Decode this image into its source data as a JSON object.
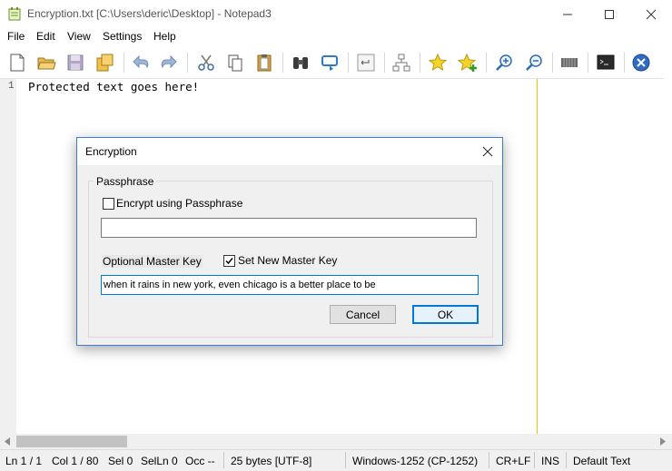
{
  "window": {
    "title": "Encryption.txt [C:\\Users\\deric\\Desktop] - Notepad3"
  },
  "menu": [
    "File",
    "Edit",
    "View",
    "Settings",
    "Help"
  ],
  "editor": {
    "line_number": "1",
    "text": "Protected text goes here!"
  },
  "dialog": {
    "title": "Encryption",
    "group_label": "Passphrase",
    "encrypt_label": "Encrypt using Passphrase",
    "encrypt_checked": false,
    "passphrase_value": "",
    "master_key_label": "Optional Master Key",
    "set_master_label": "Set New Master Key",
    "set_master_checked": true,
    "master_key_value": "when it rains in new york, even chicago is a better place to be",
    "cancel_label": "Cancel",
    "ok_label": "OK"
  },
  "status": {
    "ln": "Ln 1 / 1",
    "col": "Col 1 / 80",
    "sel": "Sel 0",
    "selln": "SelLn 0",
    "occ": "Occ --",
    "size": "25 bytes [UTF-8]",
    "encoding": "Windows-1252 (CP-1252)",
    "eol": "CR+LF",
    "ins": "INS",
    "scheme": "Default Text"
  },
  "colors": {
    "accent": "#3d7cc9",
    "edge_marker": "#e8c400"
  }
}
